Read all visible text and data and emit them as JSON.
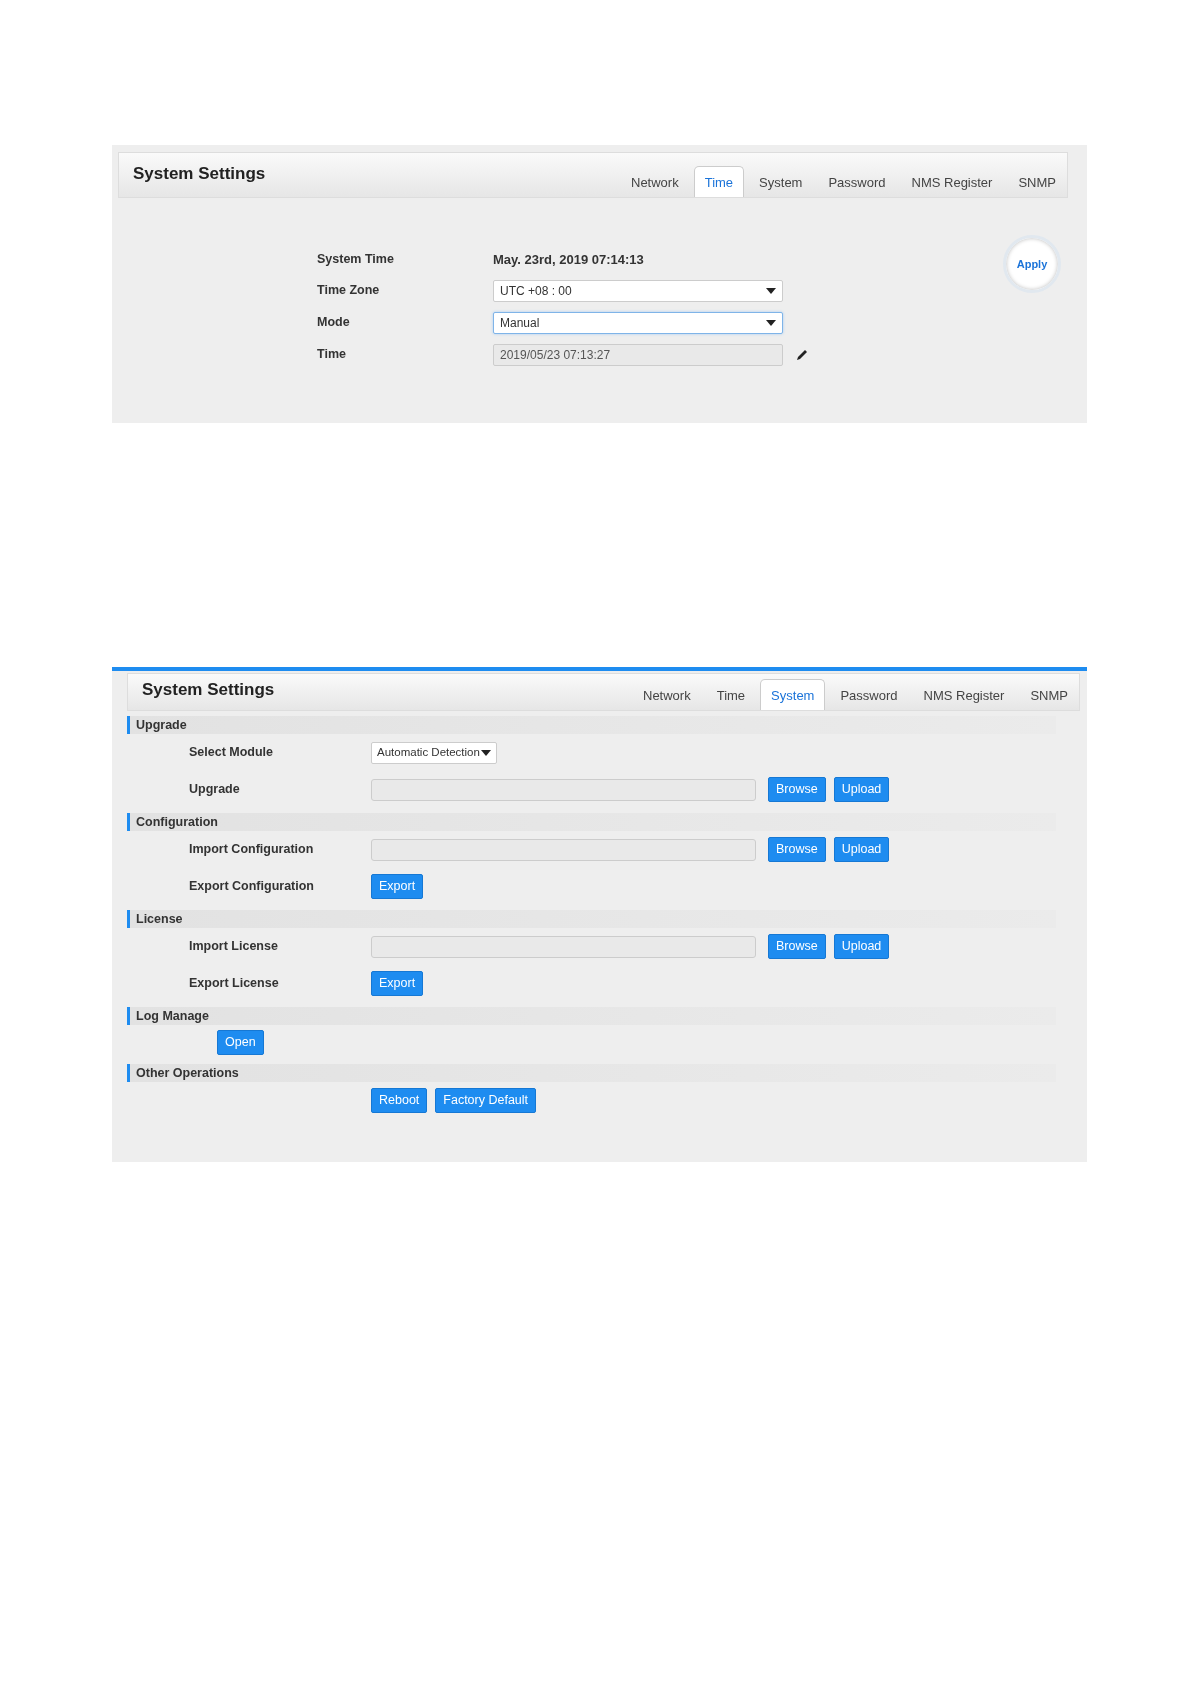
{
  "panels": [
    {
      "kind": "time",
      "title": "System Settings",
      "tabs": [
        {
          "label": "Network",
          "selected": false
        },
        {
          "label": "Time",
          "selected": true
        },
        {
          "label": "System",
          "selected": false
        },
        {
          "label": "Password",
          "selected": false
        },
        {
          "label": "NMS Register",
          "selected": false
        },
        {
          "label": "SNMP",
          "selected": false
        }
      ],
      "fields": [
        {
          "label": "System Time",
          "kind": "text",
          "value": "May. 23rd, 2019 07:14:13"
        },
        {
          "label": "Time Zone",
          "kind": "select",
          "value": "UTC +08 : 00",
          "focused": false
        },
        {
          "label": "Mode",
          "kind": "select",
          "value": "Manual",
          "focused": true
        },
        {
          "label": "Time",
          "kind": "readonly",
          "value": "2019/05/23 07:13:27"
        }
      ],
      "apply": "Apply"
    },
    {
      "kind": "system",
      "title": "System Settings",
      "tabs": [
        {
          "label": "Network",
          "selected": false
        },
        {
          "label": "Time",
          "selected": false
        },
        {
          "label": "System",
          "selected": true
        },
        {
          "label": "Password",
          "selected": false
        },
        {
          "label": "NMS Register",
          "selected": false
        },
        {
          "label": "SNMP",
          "selected": false
        }
      ],
      "sections": [
        {
          "title": "Upgrade",
          "rows": [
            {
              "kind": "select",
              "label": "Select Module",
              "value": "Automatic Detection"
            },
            {
              "kind": "file",
              "label": "Upgrade",
              "buttons": [
                "Browse",
                "Upload"
              ]
            }
          ]
        },
        {
          "title": "Configuration",
          "rows": [
            {
              "kind": "file",
              "label": "Import Configuration",
              "buttons": [
                "Browse",
                "Upload"
              ]
            },
            {
              "kind": "buttons",
              "label": "Export Configuration",
              "buttons": [
                "Export"
              ]
            }
          ]
        },
        {
          "title": "License",
          "rows": [
            {
              "kind": "file",
              "label": "Import License",
              "buttons": [
                "Browse",
                "Upload"
              ]
            },
            {
              "kind": "buttons",
              "label": "Export License",
              "buttons": [
                "Export"
              ]
            }
          ]
        },
        {
          "title": "Log Manage",
          "rows": [
            {
              "kind": "action",
              "buttons": [
                "Open"
              ]
            }
          ]
        },
        {
          "title": "Other Operations",
          "rows": [
            {
              "kind": "buttons",
              "buttons": [
                "Reboot",
                "Factory Default"
              ]
            }
          ]
        }
      ]
    }
  ]
}
